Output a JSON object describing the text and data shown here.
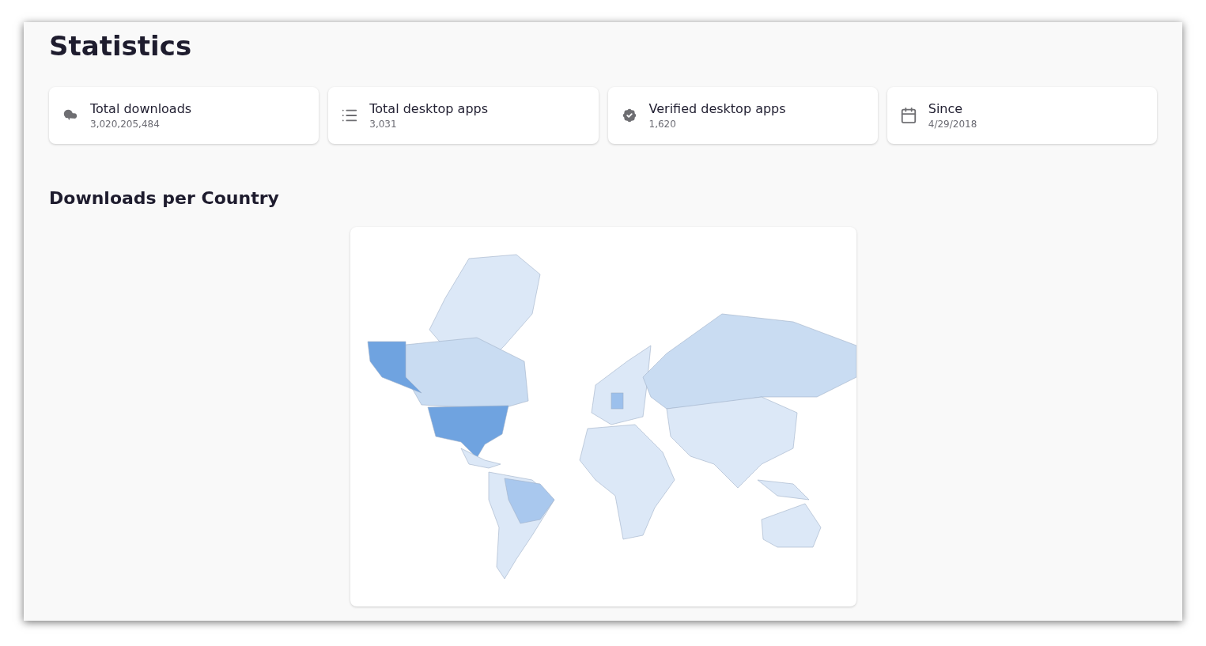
{
  "title": "Statistics",
  "stats": [
    {
      "kind": "download",
      "label": "Total downloads",
      "value": "3,020,205,484"
    },
    {
      "kind": "list",
      "label": "Total desktop apps",
      "value": "3,031"
    },
    {
      "kind": "verified",
      "label": "Verified desktop apps",
      "value": "1,620"
    },
    {
      "kind": "calendar",
      "label": "Since",
      "value": "4/29/2018"
    }
  ],
  "map_section": {
    "heading": "Downloads per Country"
  }
}
